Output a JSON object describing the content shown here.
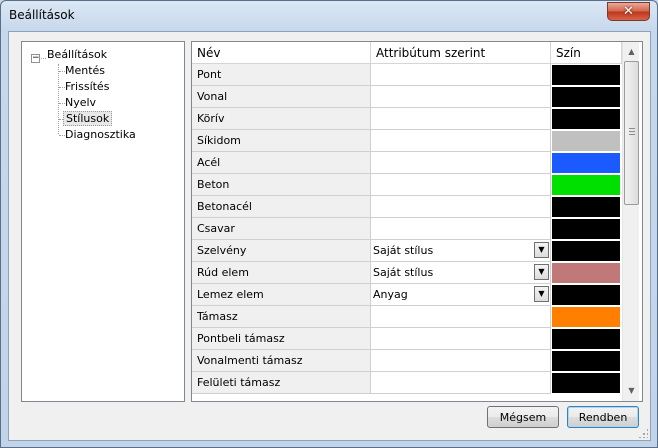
{
  "window": {
    "title": "Beállítások",
    "close_glyph": "✕"
  },
  "tree": {
    "toggle_glyph": "−",
    "root": "Beállítások",
    "children": [
      "Mentés",
      "Frissítés",
      "Nyelv",
      "Stílusok",
      "Diagnosztika"
    ],
    "selected": "Stílusok"
  },
  "grid": {
    "columns": [
      "Név",
      "Attribútum szerint",
      "Szín"
    ],
    "rows": [
      {
        "name": "Pont",
        "attr": "",
        "color": "#000000"
      },
      {
        "name": "Vonal",
        "attr": "",
        "color": "#000000"
      },
      {
        "name": "Körív",
        "attr": "",
        "color": "#000000"
      },
      {
        "name": "Síkidom",
        "attr": "",
        "color": "#c0c0c0"
      },
      {
        "name": "Acél",
        "attr": "",
        "color": "#1a5aff"
      },
      {
        "name": "Beton",
        "attr": "",
        "color": "#00e000"
      },
      {
        "name": "Betonacél",
        "attr": "",
        "color": "#000000"
      },
      {
        "name": "Csavar",
        "attr": "",
        "color": "#000000"
      },
      {
        "name": "Szelvény",
        "attr": "Saját stílus",
        "color": "#000000"
      },
      {
        "name": "Rúd elem",
        "attr": "Saját stílus",
        "color": "#c07878"
      },
      {
        "name": "Lemez elem",
        "attr": "Anyag",
        "color": "#000000"
      },
      {
        "name": "Támasz",
        "attr": "",
        "color": "#ff8000"
      },
      {
        "name": "Pontbeli támasz",
        "attr": "",
        "color": "#000000"
      },
      {
        "name": "Vonalmenti támasz",
        "attr": "",
        "color": "#000000"
      },
      {
        "name": "Felületi támasz",
        "attr": "",
        "color": "#000000"
      }
    ],
    "dropdown_glyph": "▼"
  },
  "scrollbar": {
    "up_glyph": "▲",
    "down_glyph": "▼"
  },
  "buttons": {
    "cancel": "Mégsem",
    "ok": "Rendben"
  }
}
